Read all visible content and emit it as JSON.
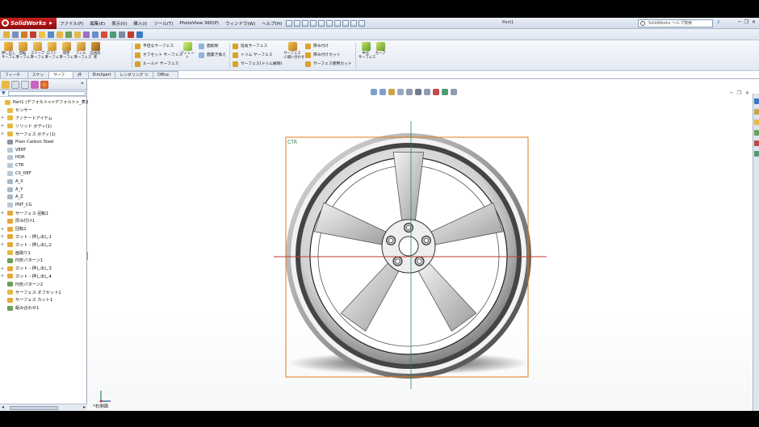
{
  "window": {
    "app_name": "SolidWorks",
    "doc_title": "Part1",
    "search_placeholder": "SolidWorks ヘルプ検索"
  },
  "menus": [
    "ファイル(F)",
    "編集(E)",
    "表示(V)",
    "挿入(I)",
    "ツール(T)",
    "PhotoView 360(P)",
    "ウィンドウ(W)",
    "ヘルプ(H)"
  ],
  "command_manager": {
    "big_buttons": [
      {
        "label": "押し出し\nサーフェス",
        "icon": "extruded-surface-icon"
      },
      {
        "label": "回転\nサーフェス",
        "icon": "revolved-surface-icon"
      },
      {
        "label": "スイープ\nサーフェス",
        "icon": "swept-surface-icon"
      },
      {
        "label": "ロフト\nサーフェス",
        "icon": "lofted-surface-icon"
      },
      {
        "label": "境界\nサーフェス",
        "icon": "boundary-surface-icon"
      },
      {
        "label": "フィル\nサーフェス",
        "icon": "filled-surface-icon"
      },
      {
        "label": "自由形\n状",
        "icon": "freeform-icon"
      }
    ],
    "group1": [
      "平坦なサーフェス",
      "オフセット サーフェス",
      "ルールド サーフェス"
    ],
    "fillet": "フィレット",
    "group2": [
      "面削除",
      "面置き換え"
    ],
    "group3": [
      "延長サーフェス",
      "トリム サーフェス",
      "サーフェス(トリム解除)"
    ],
    "knit": "サーフェス\n-ニ縫い合わせ",
    "group4": [
      "厚み付け",
      "厚み付けカット",
      "サーフェス使用カット"
    ],
    "mid_surface": "中立\nサーフェス",
    "curves": "カーブ"
  },
  "tabs": [
    "フィーチャー",
    "スケッチ",
    "サーフェス",
    "評価",
    "DimXpert",
    "レンダリング ツール",
    "Office 製品"
  ],
  "active_tab": "サーフェス",
  "feature_tree": [
    {
      "label": "Part1 (デフォルト<<デフォルト>_表示状態",
      "icon": "part-icon",
      "expander": "",
      "indent": 0
    },
    {
      "label": "センサー",
      "icon": "sensors-icon",
      "expander": "",
      "indent": 1
    },
    {
      "label": "アノテートアイテム",
      "icon": "annotations-icon",
      "expander": "+",
      "indent": 1
    },
    {
      "label": "ソリッド ボディ(1)",
      "icon": "solid-bodies-icon",
      "expander": "+",
      "indent": 1
    },
    {
      "label": "サーフェス ボディ(1)",
      "icon": "surface-bodies-icon",
      "expander": "+",
      "indent": 1
    },
    {
      "label": "Plain Carbon Steel",
      "icon": "material-icon",
      "expander": "",
      "indent": 1
    },
    {
      "label": "VERT",
      "icon": "plane-icon",
      "expander": "",
      "indent": 1
    },
    {
      "label": "HOR",
      "icon": "plane-icon",
      "expander": "",
      "indent": 1
    },
    {
      "label": "CTR",
      "icon": "plane-icon",
      "expander": "",
      "indent": 1
    },
    {
      "label": "CS_DEF",
      "icon": "coordinate-system-icon",
      "expander": "",
      "indent": 1
    },
    {
      "label": "A_X",
      "icon": "axis-icon",
      "expander": "",
      "indent": 1
    },
    {
      "label": "A_Y",
      "icon": "axis-icon",
      "expander": "",
      "indent": 1
    },
    {
      "label": "A_Z",
      "icon": "axis-icon",
      "expander": "",
      "indent": 1
    },
    {
      "label": "PNT_CG",
      "icon": "point-icon",
      "expander": "",
      "indent": 1
    },
    {
      "label": "サーフェス-回転1",
      "icon": "surface-revolve-icon",
      "expander": "+",
      "indent": 1
    },
    {
      "label": "厚み付け1",
      "icon": "thicken-icon",
      "expander": "",
      "indent": 1
    },
    {
      "label": "回転1",
      "icon": "revolve-icon",
      "expander": "+",
      "indent": 1
    },
    {
      "label": "カット - 押し出し1",
      "icon": "cut-extrude-icon",
      "expander": "+",
      "indent": 1
    },
    {
      "label": "カット - 押し出し2",
      "icon": "cut-extrude-icon",
      "expander": "+",
      "indent": 1
    },
    {
      "label": "面取り1",
      "icon": "chamfer-icon",
      "expander": "",
      "indent": 1
    },
    {
      "label": "円形パターン1",
      "icon": "circular-pattern-icon",
      "expander": "",
      "indent": 1
    },
    {
      "label": "カット - 押し出し3",
      "icon": "cut-extrude-icon",
      "expander": "+",
      "indent": 1
    },
    {
      "label": "カット - 押し出し4",
      "icon": "cut-extrude-icon",
      "expander": "+",
      "indent": 1
    },
    {
      "label": "円形パターン2",
      "icon": "circular-pattern-icon",
      "expander": "",
      "indent": 1
    },
    {
      "label": "サーフェス-オフセット1",
      "icon": "surface-offset-icon",
      "expander": "",
      "indent": 1
    },
    {
      "label": "サーフェス カット1",
      "icon": "surface-cut-icon",
      "expander": "",
      "indent": 1
    },
    {
      "label": "組み合わせ1",
      "icon": "combine-icon",
      "expander": "",
      "indent": 1
    }
  ],
  "graphics": {
    "plane_label": "CTR",
    "view_label": "*右側面"
  },
  "colors": {
    "selection_box": "#e07a1e",
    "axis_red": "#c0392b",
    "axis_green": "#27885a",
    "logo_red": "#c72020"
  }
}
